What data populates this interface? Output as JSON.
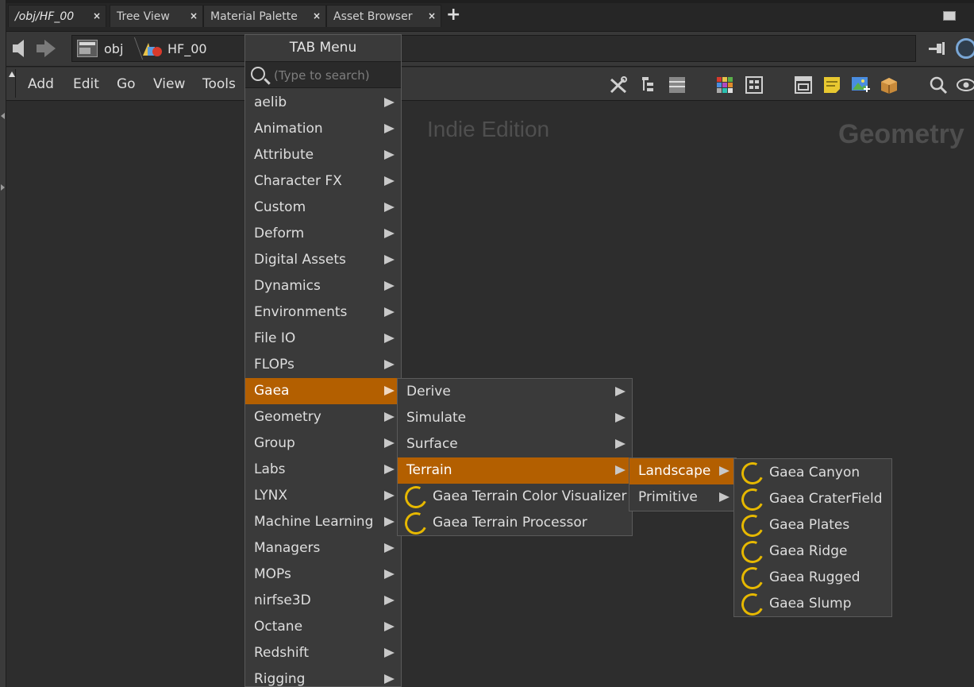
{
  "tabs": [
    {
      "label": "/obj/HF_00",
      "active": true
    },
    {
      "label": "Tree View",
      "active": false
    },
    {
      "label": "Material Palette",
      "active": false
    },
    {
      "label": "Asset Browser",
      "active": false
    }
  ],
  "tab_close_glyph": "×",
  "tab_add_glyph": "+",
  "path": {
    "crumb1": "obj",
    "crumb2": "HF_00"
  },
  "menubar": {
    "add": "Add",
    "edit": "Edit",
    "go": "Go",
    "view": "View",
    "tools": "Tools"
  },
  "network": {
    "watermark": "Indie Edition",
    "context_label": "Geometry"
  },
  "tab_menu": {
    "title": "TAB Menu",
    "search_placeholder": "(Type to search)",
    "items": [
      "aelib",
      "Animation",
      "Attribute",
      "Character FX",
      "Custom",
      "Deform",
      "Digital Assets",
      "Dynamics",
      "Environments",
      "File IO",
      "FLOPs",
      "Gaea",
      "Geometry",
      "Group",
      "Labs",
      "LYNX",
      "Machine Learning",
      "Managers",
      "MOPs",
      "nirfse3D",
      "Octane",
      "Redshift",
      "Rigging"
    ],
    "highlighted": "Gaea"
  },
  "gaea_submenu": {
    "items": [
      "Derive",
      "Simulate",
      "Surface",
      "Terrain"
    ],
    "highlighted": "Terrain",
    "nodes": [
      "Gaea Terrain Color Visualizer",
      "Gaea Terrain Processor"
    ]
  },
  "terrain_submenu": {
    "items": [
      "Landscape",
      "Primitive"
    ],
    "highlighted": "Landscape"
  },
  "landscape_submenu": {
    "nodes": [
      "Gaea Canyon",
      "Gaea CraterField",
      "Gaea Plates",
      "Gaea Ridge",
      "Gaea Rugged",
      "Gaea Slump"
    ]
  },
  "colors": {
    "highlight": "#b35f00",
    "node_icon": "#e6b800",
    "background": "#2d2d2d"
  }
}
